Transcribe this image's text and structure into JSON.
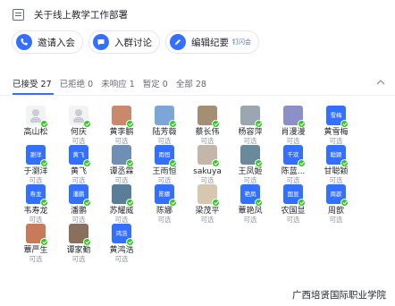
{
  "header": {
    "title": "关于线上教学工作部署",
    "icon": "document-icon"
  },
  "actions": [
    {
      "label": "邀请入会",
      "icon": "phone-icon",
      "badge": ""
    },
    {
      "label": "入群讨论",
      "icon": "chat-bubble-icon",
      "badge": ""
    },
    {
      "label": "编辑纪要",
      "icon": "edit-icon",
      "badge": "钉闪会"
    }
  ],
  "tabs": [
    {
      "label": "已接受 27",
      "active": true
    },
    {
      "label": "已拒绝 0",
      "active": false
    },
    {
      "label": "未响应 1",
      "active": false
    },
    {
      "label": "暂定 0",
      "active": false
    },
    {
      "label": "全部 28",
      "active": false
    }
  ],
  "members": [
    {
      "name": "高山松",
      "status": "",
      "avatar": "",
      "color": "default"
    },
    {
      "name": "何庆",
      "status": "可选",
      "avatar": "",
      "color": "default"
    },
    {
      "name": "黄李鹏",
      "status": "可选",
      "avatar": "",
      "color": "#c98a6b"
    },
    {
      "name": "陆芳薇",
      "status": "可选",
      "avatar": "",
      "color": "#7da6d8"
    },
    {
      "name": "蔡长伟",
      "status": "可选",
      "avatar": "",
      "color": "#a58e74"
    },
    {
      "name": "杨容萍",
      "status": "可选",
      "avatar": "",
      "color": "#9aa6b2"
    },
    {
      "name": "肖漫漫",
      "status": "可选",
      "avatar": "",
      "color": "#8b90c9"
    },
    {
      "name": "黄雪梅",
      "status": "可选",
      "avatar": "雪梅",
      "color": "#3370ff"
    },
    {
      "name": "于瀏洋",
      "status": "可选",
      "avatar": "瀏洋",
      "color": "#3370ff"
    },
    {
      "name": "黄飞",
      "status": "可选",
      "avatar": "黄飞",
      "color": "#3370ff"
    },
    {
      "name": "谭丞霖",
      "status": "可选",
      "avatar": "",
      "color": "#6f8fb5"
    },
    {
      "name": "王雨恒",
      "status": "可选",
      "avatar": "雨恒",
      "color": "#3370ff"
    },
    {
      "name": "sakuya",
      "status": "可选",
      "avatar": "",
      "color": "#c4b6a8"
    },
    {
      "name": "王凤姬",
      "status": "可选",
      "avatar": "",
      "color": "#6a8a9c"
    },
    {
      "name": "陈蓝...",
      "status": "可选",
      "avatar": "千欢",
      "color": "#3370ff"
    },
    {
      "name": "甘聪颖",
      "status": "可选",
      "avatar": "聪颖",
      "color": "#3370ff"
    },
    {
      "name": "韦寿龙",
      "status": "可选",
      "avatar": "寿龙",
      "color": "#3370ff"
    },
    {
      "name": "潘鹏",
      "status": "可选",
      "avatar": "潘鹏",
      "color": "#3370ff"
    },
    {
      "name": "苏耀威",
      "status": "可选",
      "avatar": "",
      "color": "#5a7d9a"
    },
    {
      "name": "陈娜",
      "status": "可选",
      "avatar": "陈娜",
      "color": "#3370ff"
    },
    {
      "name": "梁茂平",
      "status": "可选",
      "avatar": "",
      "color": "#d7c7b0"
    },
    {
      "name": "蕈艳凤",
      "status": "可选",
      "avatar": "艳凤",
      "color": "#3370ff"
    },
    {
      "name": "农国显",
      "status": "可选",
      "avatar": "国显",
      "color": "#3370ff"
    },
    {
      "name": "周歆",
      "status": "可选",
      "avatar": "周歆",
      "color": "#3370ff"
    },
    {
      "name": "蕈严生",
      "status": "可选",
      "avatar": "",
      "color": "#c97a5a"
    },
    {
      "name": "谭家勤",
      "status": "可选",
      "avatar": "",
      "color": "#8a6f5c"
    },
    {
      "name": "黄鸿浩",
      "status": "可选",
      "avatar": "鸿浩",
      "color": "#3370ff"
    }
  ],
  "watermark": "广西培贤国际职业学院",
  "colors": {
    "accent": "#3370ff",
    "check": "#34c724"
  }
}
